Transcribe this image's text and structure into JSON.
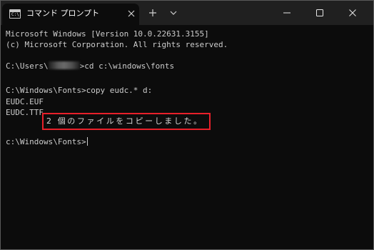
{
  "window": {
    "tab_title": "コマンド プロンプト",
    "tab_icon_text": "C:\\."
  },
  "console": {
    "line1": "Microsoft Windows [Version 10.0.22631.3155]",
    "line2": "(c) Microsoft Corporation. All rights reserved.",
    "line3_prefix": "C:\\Users\\",
    "line3_suffix": ">cd c:\\windows\\fonts",
    "line4": "C:\\Windows\\Fonts>copy eudc.* d:",
    "line5": "EUDC.EUF",
    "line6": "EUDC.TTF",
    "copy_message": "2 個のファイルをコピーしました。",
    "prompt": "c:\\Windows\\Fonts>"
  },
  "colors": {
    "console_bg": "#0c0c0c",
    "titlebar_bg": "#202020",
    "console_text": "#cccccc",
    "highlight_border": "#e8202a"
  },
  "icons": {
    "tab": "cmd-icon",
    "tab_close": "close-icon",
    "new_tab": "plus-icon",
    "tab_dropdown": "chevron-down-icon",
    "minimize": "minimize-icon",
    "maximize": "maximize-icon",
    "close": "close-icon"
  }
}
